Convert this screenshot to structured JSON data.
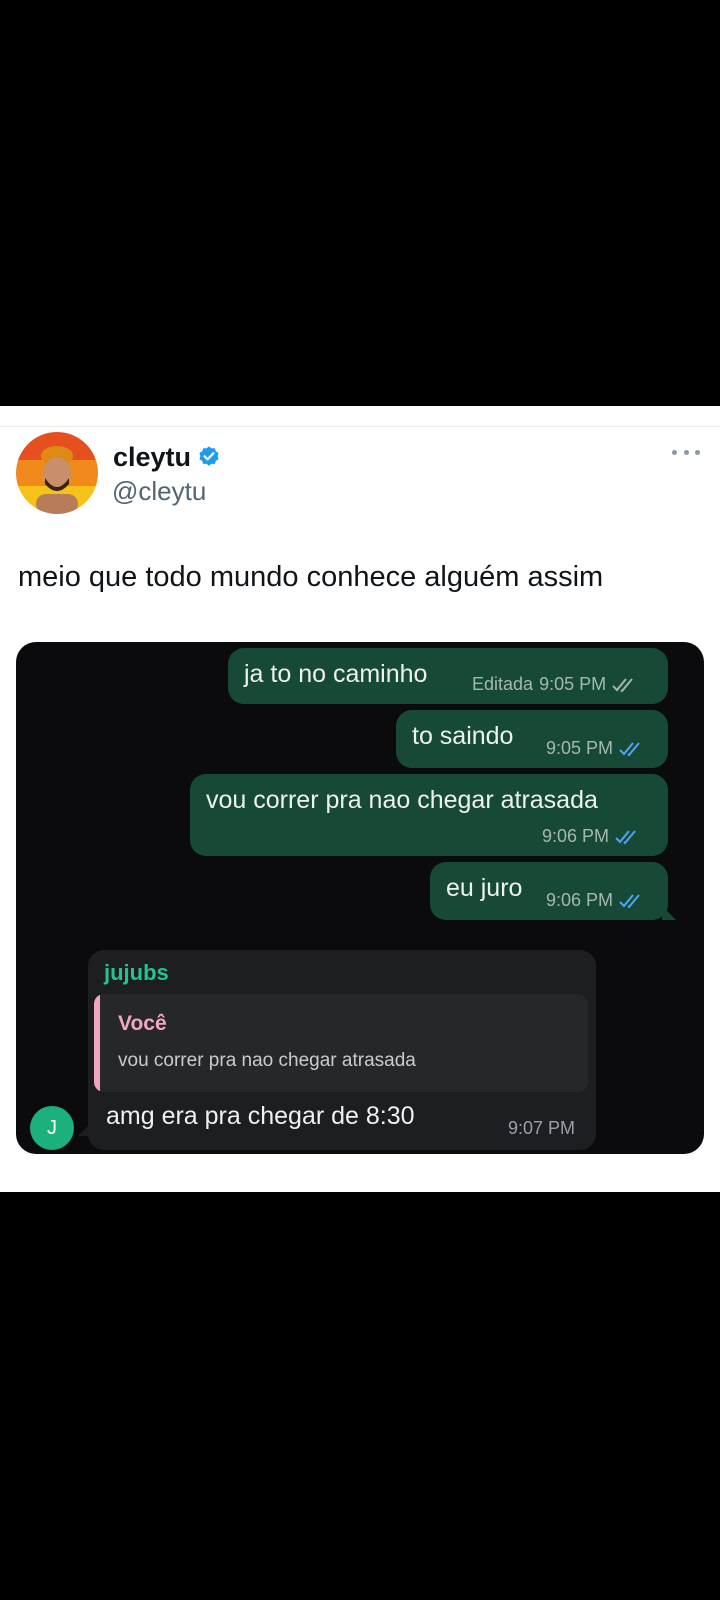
{
  "tweet": {
    "display_name": "cleytu",
    "handle": "@cleytu",
    "text": "meio que todo mundo conhece alguém assim",
    "icons": {
      "verified": "verified-badge-icon",
      "more": "more-options-icon"
    },
    "colors": {
      "verified": "#1d9bf0"
    }
  },
  "chat": {
    "outgoing": [
      {
        "text": "ja to no caminho",
        "edited_label": "Editada",
        "time": "9:05 PM"
      },
      {
        "text": "to saindo",
        "time": "9:05 PM"
      },
      {
        "text": "vou correr pra nao chegar atrasada",
        "time": "9:06 PM"
      },
      {
        "text": "eu juro",
        "time": "9:06 PM"
      }
    ],
    "incoming": {
      "sender": "jujubs",
      "reply_author": "Você",
      "reply_text": "vou correr pra nao chegar atrasada",
      "text": "amg era pra chegar de 8:30",
      "time": "9:07 PM",
      "avatar_initial": "J"
    },
    "colors": {
      "outgoing_bubble": "#164a36",
      "incoming_bubble": "#1d1e21",
      "read_ticks": "#4fa3f7",
      "sender_name": "#25c28d",
      "reply_accent": "#f3a6c2"
    }
  }
}
